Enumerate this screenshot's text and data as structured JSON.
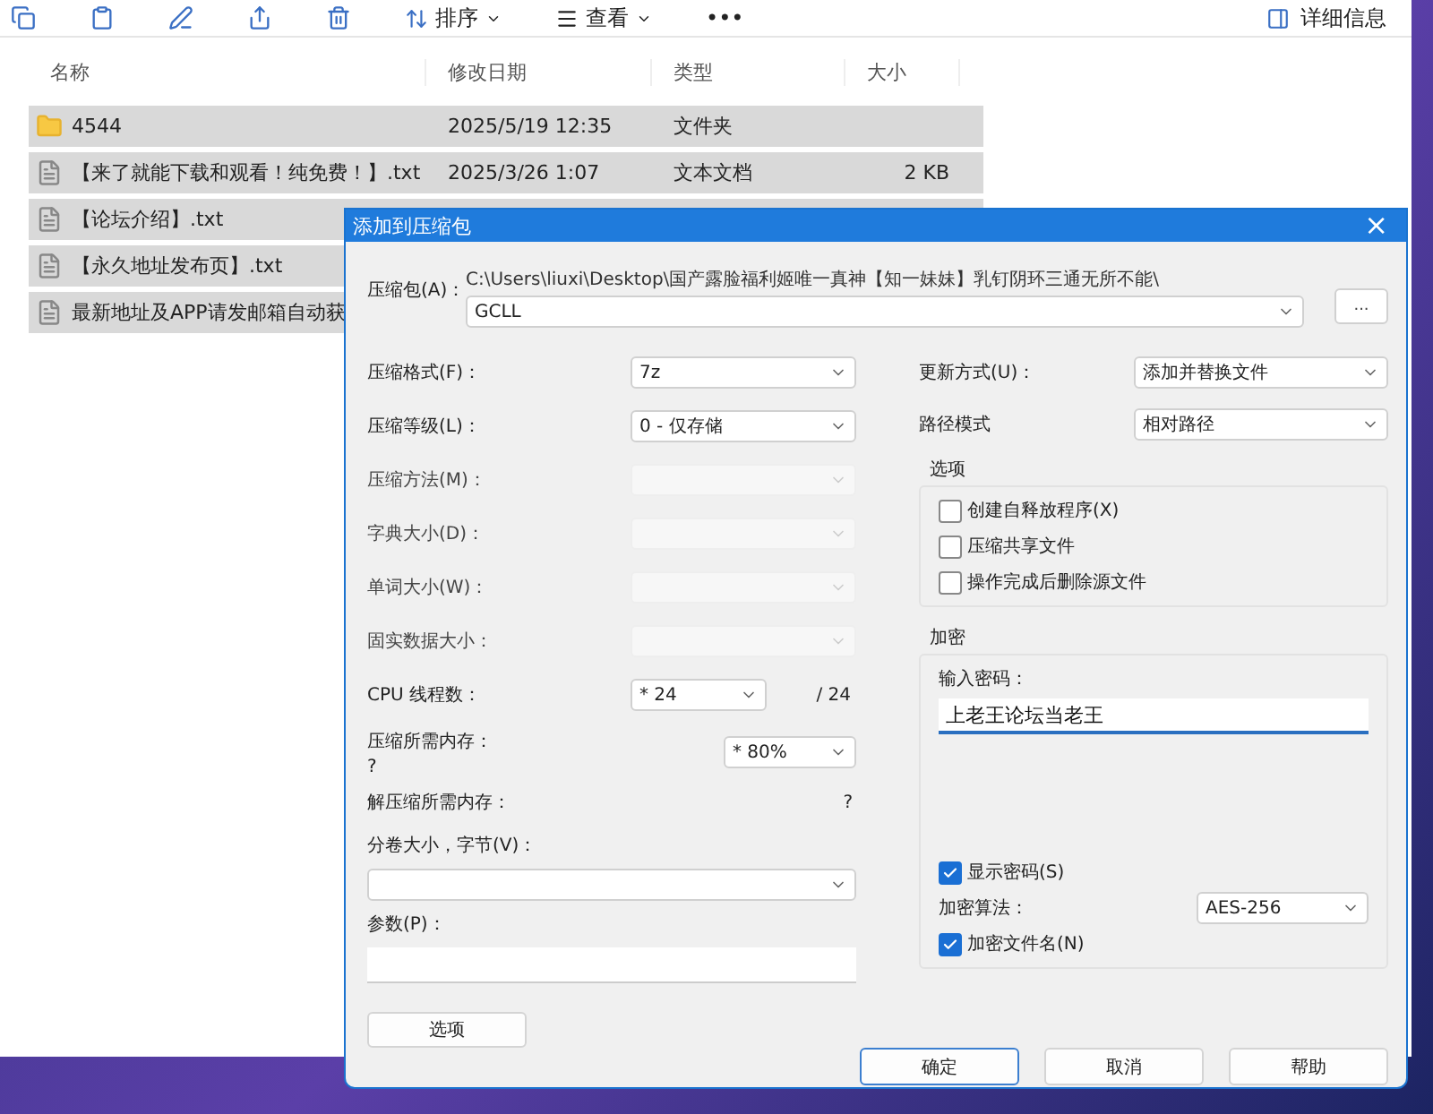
{
  "explorer": {
    "toolbar": [
      {
        "kind": "copy"
      },
      {
        "kind": "paste"
      },
      {
        "kind": "rename"
      },
      {
        "kind": "share"
      },
      {
        "kind": "delete"
      },
      {
        "kind": "sort",
        "label": "排序"
      },
      {
        "kind": "view",
        "label": "查看"
      },
      {
        "kind": "more",
        "label": "•••"
      }
    ],
    "details_button": "详细信息",
    "columns": [
      "名称",
      "修改日期",
      "类型",
      "大小"
    ],
    "rows": [
      {
        "kind": "folder",
        "name": "4544",
        "date": "2025/5/19 12:35",
        "type": "文件夹",
        "selected": true
      },
      {
        "kind": "text",
        "name": "【来了就能下载和观看！纯免费！】.txt",
        "date": "2025/3/26 1:07",
        "type": "文本文档",
        "size": "2 KB",
        "selected": true
      },
      {
        "kind": "text",
        "name": "【论坛介绍】.txt",
        "selected": true
      },
      {
        "kind": "text",
        "name": "【永久地址发布页】.txt",
        "selected": true
      },
      {
        "kind": "text",
        "name": "最新地址及APP请发邮箱自动获",
        "selected": true
      }
    ]
  },
  "dialog": {
    "title": "添加到压缩包",
    "close": "×",
    "archive": {
      "label": "压缩包(A)：",
      "path": "C:\\Users\\liuxi\\Desktop\\国产露脸福利姬唯一真神【知一妹妹】乳钉阴环三通无所不能\\",
      "value": "GCLL",
      "browse": "..."
    },
    "left_rows": [
      {
        "kind": "select",
        "label": "压缩格式(F)：",
        "value": "7z",
        "disabled": false
      },
      {
        "kind": "select",
        "label": "压缩等级(L)：",
        "value": "0 - 仅存储",
        "disabled": false
      },
      {
        "kind": "select",
        "label": "压缩方法(M)：",
        "disabled": true
      },
      {
        "kind": "select",
        "label": "字典大小(D)：",
        "disabled": true
      },
      {
        "kind": "select",
        "label": "单词大小(W)：",
        "disabled": true
      },
      {
        "kind": "select",
        "label": "固实数据大小：",
        "disabled": true
      },
      {
        "kind": "threads",
        "label": "CPU 线程数：",
        "value": "* 24",
        "total": "/ 24"
      },
      {
        "kind": "memory",
        "label": "压缩所需内存：",
        "note": "?",
        "value": "* 80%"
      },
      {
        "kind": "info",
        "label": "解压缩所需内存：",
        "note": "?"
      },
      {
        "kind": "wide_select",
        "label": "分卷大小，字节(V)："
      },
      {
        "kind": "text_input",
        "label": "参数(P)："
      }
    ],
    "options_button": "选项",
    "update_mode": {
      "label": "更新方式(U)：",
      "value": "添加并替换文件"
    },
    "path_mode": {
      "label": "路径模式",
      "value": "相对路径"
    },
    "options_group": {
      "title": "选项",
      "items": [
        {
          "label": "创建自释放程序(X)",
          "checked": false
        },
        {
          "label": "压缩共享文件",
          "checked": false
        },
        {
          "label": "操作完成后删除源文件",
          "checked": false
        }
      ]
    },
    "encryption": {
      "title": "加密",
      "password_label": "输入密码：",
      "password": "上老王论坛当老王",
      "show_password": {
        "label": "显示密码(S)",
        "checked": true
      },
      "method_label": "加密算法：",
      "method": "AES-256",
      "encrypt_names": {
        "label": "加密文件名(N)",
        "checked": true
      }
    },
    "buttons": [
      {
        "label": "确定",
        "default": true
      },
      {
        "label": "取消",
        "default": false
      },
      {
        "label": "帮助",
        "default": false
      }
    ]
  }
}
